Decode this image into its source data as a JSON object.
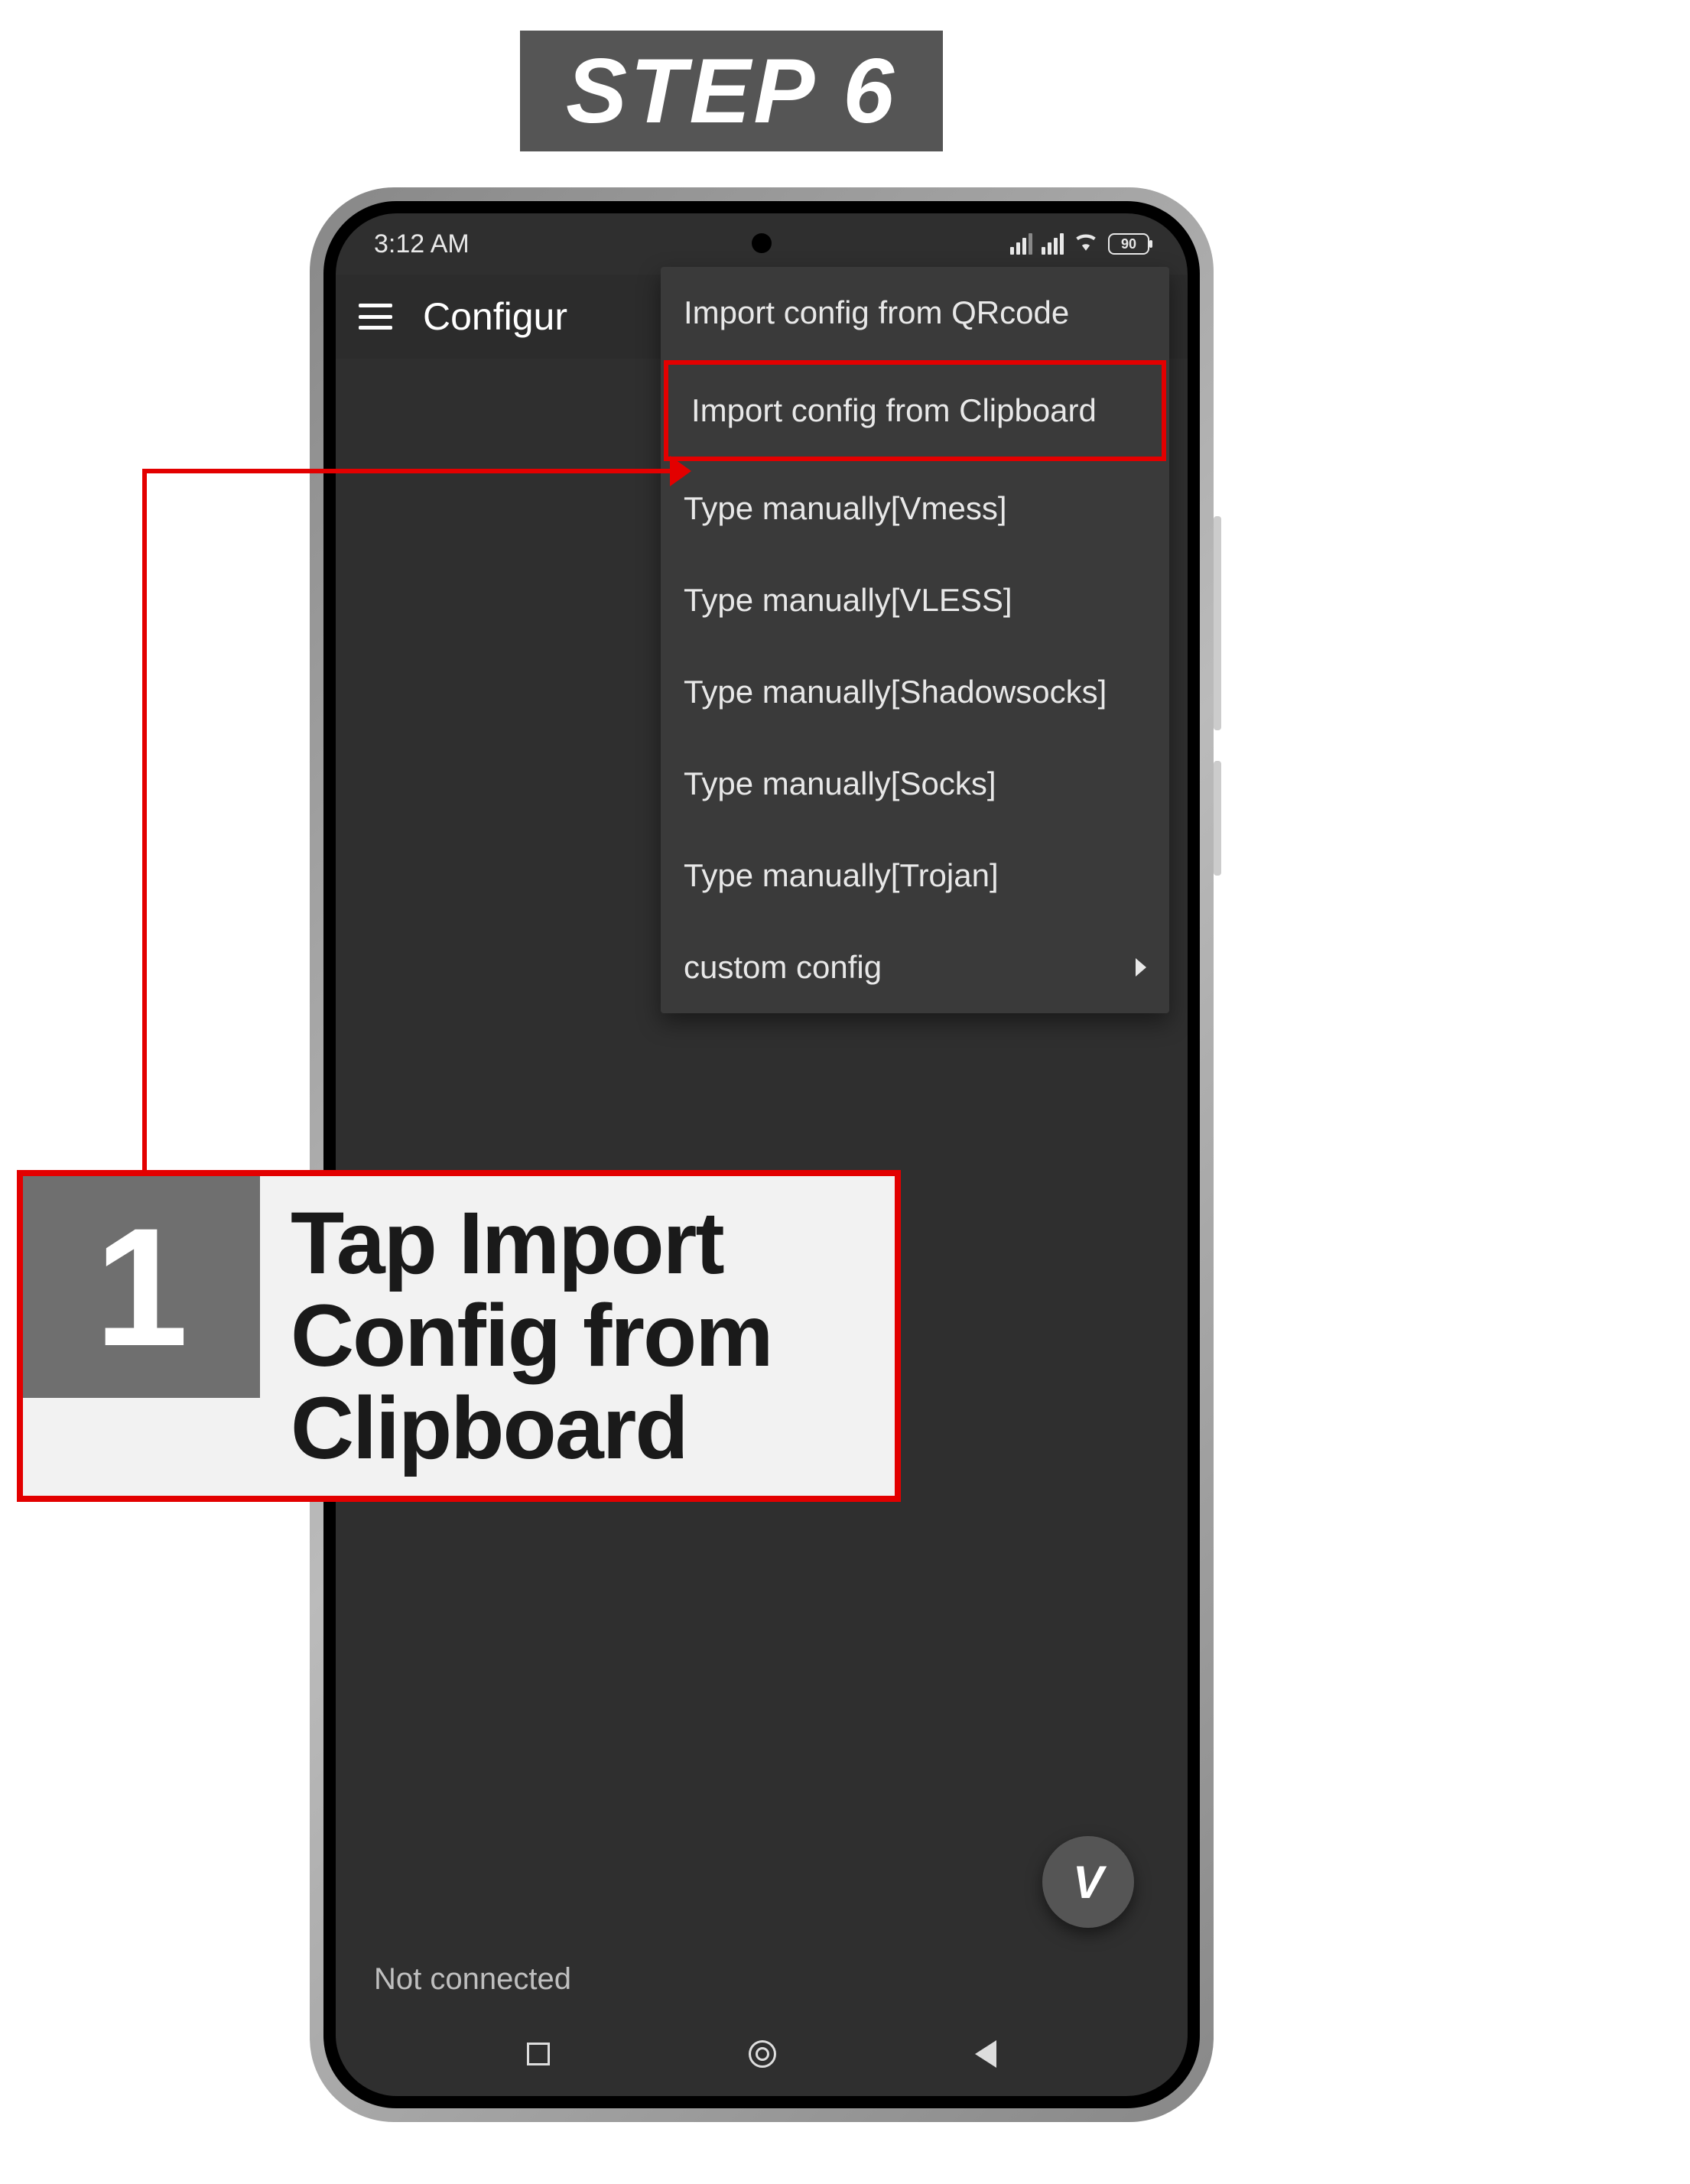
{
  "step_label": "STEP 6",
  "status_bar": {
    "time": "3:12 AM",
    "battery_text": "90"
  },
  "app_bar": {
    "title": "Configur"
  },
  "menu_items": [
    {
      "label": "Import config from QRcode",
      "has_arrow": false,
      "highlighted": false
    },
    {
      "label": "Import config from Clipboard",
      "has_arrow": false,
      "highlighted": true
    },
    {
      "label": "Type manually[Vmess]",
      "has_arrow": false,
      "highlighted": false
    },
    {
      "label": "Type manually[VLESS]",
      "has_arrow": false,
      "highlighted": false
    },
    {
      "label": "Type manually[Shadowsocks]",
      "has_arrow": false,
      "highlighted": false
    },
    {
      "label": "Type manually[Socks]",
      "has_arrow": false,
      "highlighted": false
    },
    {
      "label": "Type manually[Trojan]",
      "has_arrow": false,
      "highlighted": false
    },
    {
      "label": "custom config",
      "has_arrow": true,
      "highlighted": false
    }
  ],
  "connection_status": "Not connected",
  "fab_label": "V",
  "callout": {
    "number": "1",
    "text": "Tap Import Config from Clipboard"
  }
}
